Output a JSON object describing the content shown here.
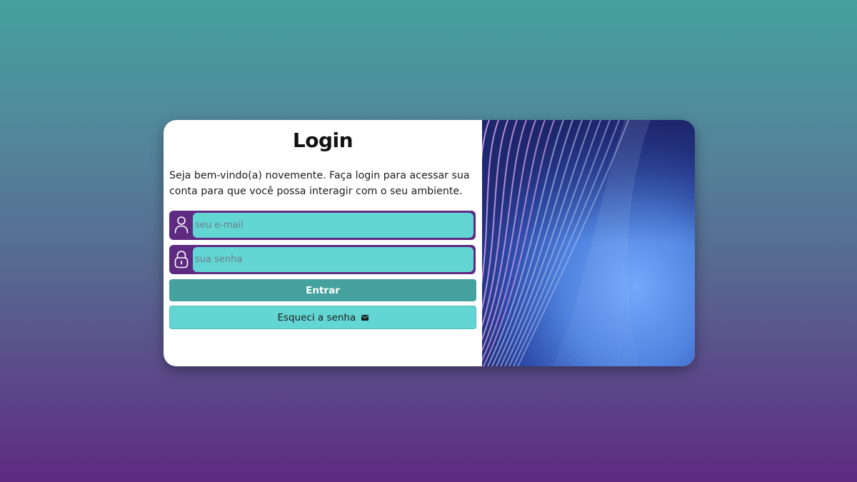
{
  "login": {
    "title": "Login",
    "welcome_text": "Seja bem-vindo(a) novemente. Faça login para acessar sua conta para que você possa interagir com o seu ambiente.",
    "email": {
      "placeholder": "seu e-mail",
      "value": "",
      "icon": "user-icon"
    },
    "password": {
      "placeholder": "sua senha",
      "value": "",
      "icon": "lock-icon"
    },
    "submit_label": "Entrar",
    "forgot_label": "Esqueci a senha",
    "forgot_icon": "envelope-icon"
  },
  "colors": {
    "background_top": "#45a19d",
    "background_bottom": "#5e2a82",
    "field_border": "#5e2a82",
    "input_bg": "#63d6d4",
    "submit_bg": "#45a19d",
    "forgot_bg": "#63d6d4",
    "card_bg": "#ffffff"
  }
}
